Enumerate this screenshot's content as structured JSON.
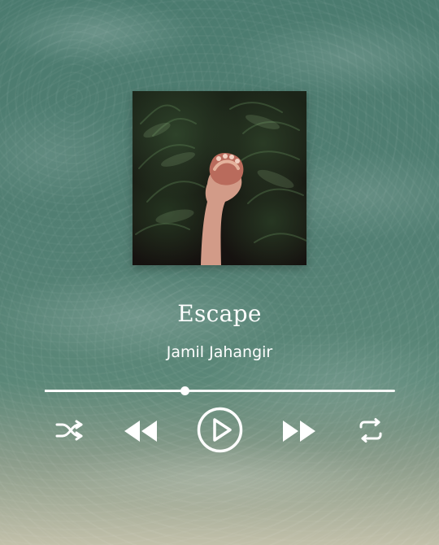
{
  "player": {
    "track_title": "Escape",
    "artist": "Jamil Jahangir",
    "progress": 0.4
  },
  "icons": {
    "shuffle": "shuffle-icon",
    "previous": "rewind-icon",
    "play": "play-icon",
    "next": "fast-forward-icon",
    "repeat": "repeat-icon"
  },
  "colors": {
    "foreground": "#ffffff",
    "background_primary": "#4f7f72",
    "background_secondary": "#c2c0aa"
  }
}
